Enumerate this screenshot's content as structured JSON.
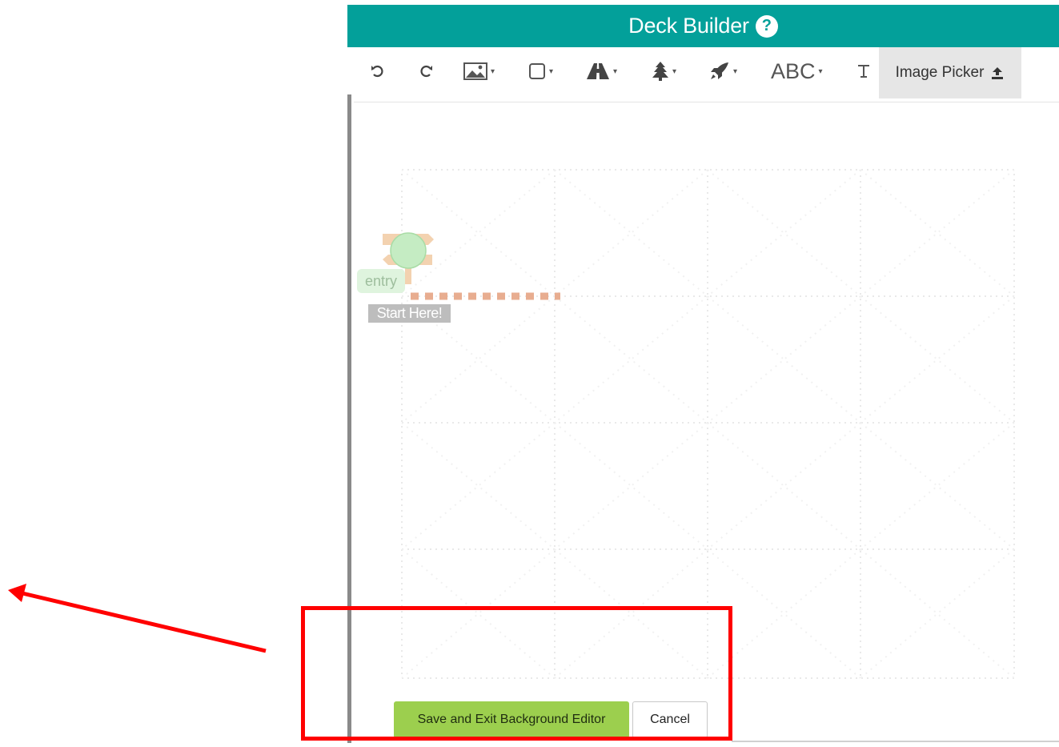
{
  "header": {
    "title": "Deck Builder",
    "help_glyph": "?"
  },
  "toolbar": {
    "tools": [
      {
        "name": "undo-icon"
      },
      {
        "name": "redo-icon"
      },
      {
        "name": "image-icon"
      },
      {
        "name": "square-icon"
      },
      {
        "name": "road-icon"
      },
      {
        "name": "tree-icon"
      },
      {
        "name": "rocket-icon"
      },
      {
        "name": "text-tool",
        "label": "ABC"
      },
      {
        "name": "text-format-icon"
      }
    ],
    "image_picker": {
      "label": "Image Picker"
    }
  },
  "canvas": {
    "entry_label": "entry",
    "start_label": "Start Here!"
  },
  "actions": {
    "save_label": "Save and Exit Background Editor",
    "cancel_label": "Cancel"
  },
  "colors": {
    "header_bg": "#03a09a",
    "save_bg": "#9ccf4e",
    "annotation": "#ff0000"
  }
}
